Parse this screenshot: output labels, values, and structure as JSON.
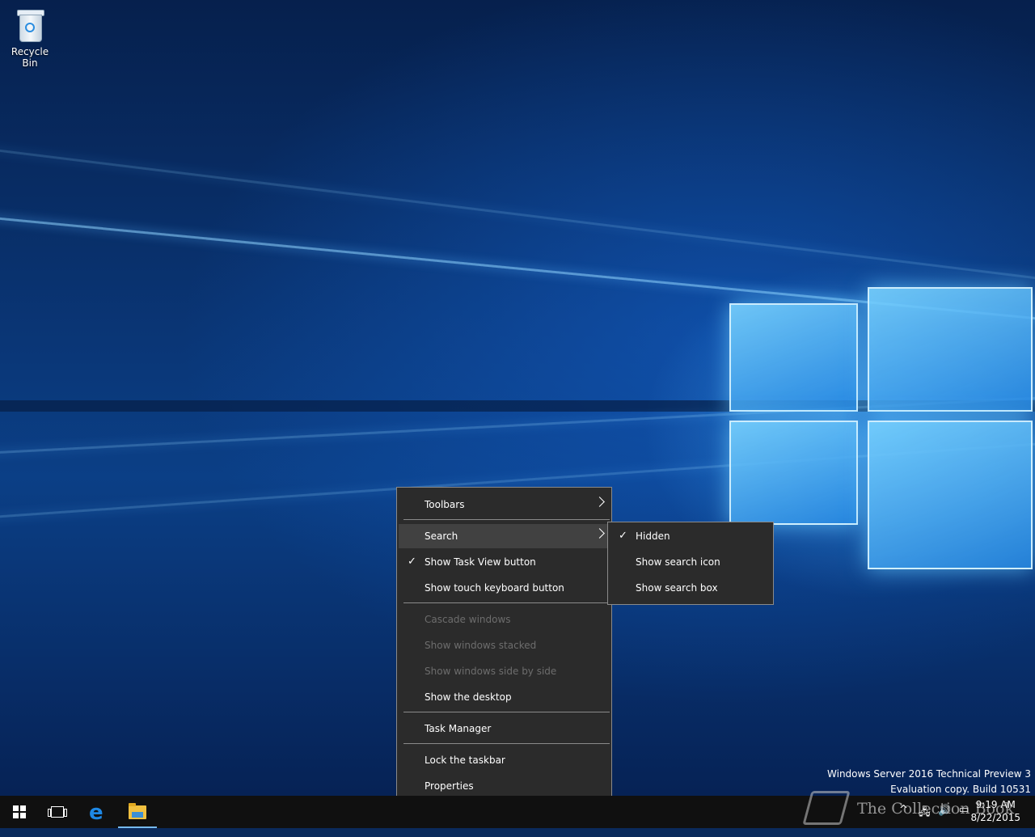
{
  "desktop": {
    "icons": [
      {
        "label": "Recycle Bin",
        "icon": "recycle-bin-icon"
      }
    ],
    "watermark": {
      "line1": "Windows Server 2016 Technical Preview 3",
      "line2": "Evaluation copy. Build 10531"
    }
  },
  "context_menu": {
    "items": [
      {
        "label": "Toolbars",
        "submenu": true
      },
      {
        "label": "Search",
        "submenu": true,
        "highlighted": true
      },
      {
        "label": "Show Task View button",
        "checked": true
      },
      {
        "label": "Show touch keyboard button"
      },
      {
        "label": "Cascade windows",
        "disabled": true
      },
      {
        "label": "Show windows stacked",
        "disabled": true
      },
      {
        "label": "Show windows side by side",
        "disabled": true
      },
      {
        "label": "Show the desktop"
      },
      {
        "label": "Task Manager"
      },
      {
        "label": "Lock the taskbar"
      },
      {
        "label": "Properties"
      }
    ]
  },
  "search_submenu": {
    "items": [
      {
        "label": "Hidden",
        "checked": true
      },
      {
        "label": "Show search icon"
      },
      {
        "label": "Show search box"
      }
    ]
  },
  "taskbar": {
    "buttons": [
      "start-icon",
      "task-view-icon",
      "edge-icon",
      "file-explorer-icon"
    ],
    "clock": {
      "time": "9:19 AM",
      "date": "8/22/2015"
    },
    "overlay_text": "The Collection Book"
  },
  "glyphs": {
    "check": "✓",
    "chevron_up": "^",
    "speaker": "🔊",
    "message": "▭",
    "network": "🖧"
  }
}
